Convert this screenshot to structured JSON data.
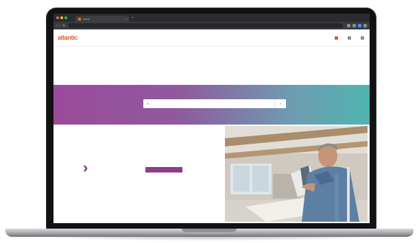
{
  "browser": {
    "tab_title": "Atlantic",
    "tab_close": "×",
    "tab_new": "+",
    "url": "",
    "nav_back": "‹",
    "nav_forward": "›",
    "nav_reload": "↻"
  },
  "site": {
    "logo": "atlantic",
    "header_links": [
      {
        "label": "",
        "icon": "home-icon"
      },
      {
        "label": "",
        "icon": "user-icon"
      },
      {
        "label": "",
        "icon": "cart-icon"
      }
    ],
    "nav": [
      "",
      "",
      ""
    ],
    "welcome": "",
    "search": {
      "placeholder": "",
      "left_icon": "≡",
      "button_icon": "⌕"
    },
    "info": {
      "title": "",
      "lines": [
        "",
        ""
      ]
    },
    "cta": {
      "title": "",
      "note": "",
      "button": ""
    }
  },
  "colors": {
    "brand": "#e4572e",
    "accent": "#8d3f87",
    "hero_start": "#9b4a9a",
    "hero_end": "#4fb5b1"
  }
}
